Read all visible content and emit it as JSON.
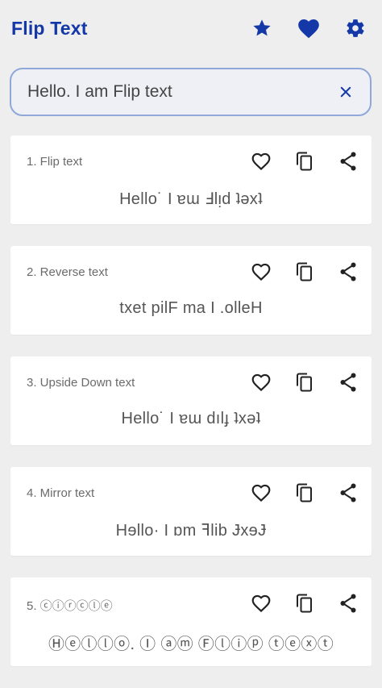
{
  "app_bar": {
    "title": "Flip Text",
    "icons": [
      "star-icon",
      "heart-icon",
      "gear-icon"
    ],
    "accent_color": "#1538a8"
  },
  "search": {
    "value": "Hello. I am Flip text",
    "clear_icon": "close-icon"
  },
  "cards": [
    {
      "label": "1. Flip text",
      "output": "Hello˙ I ɐɯ Ⅎlᴉd ʇǝxʇ"
    },
    {
      "label": "2. Reverse text",
      "output": "txet pilF ma I .olleH"
    },
    {
      "label": "3. Upside Down text",
      "output": "Hello˙ I ɐɯ dılɟ ʇxǝʇ"
    },
    {
      "label": "4. Mirror text",
      "output": "Hɘllo· I ɒm ꟻlib ɈxɘɈ"
    },
    {
      "label": "5. ⓒⓘⓡⓒⓛⓔ",
      "output": "Ⓗⓔⓛⓛⓞ. Ⓘ ⓐⓜ Ⓕⓛⓘⓟ ⓣⓔⓧⓣ"
    }
  ],
  "card_icons": [
    "heart-outline-icon",
    "copy-icon",
    "share-icon"
  ]
}
